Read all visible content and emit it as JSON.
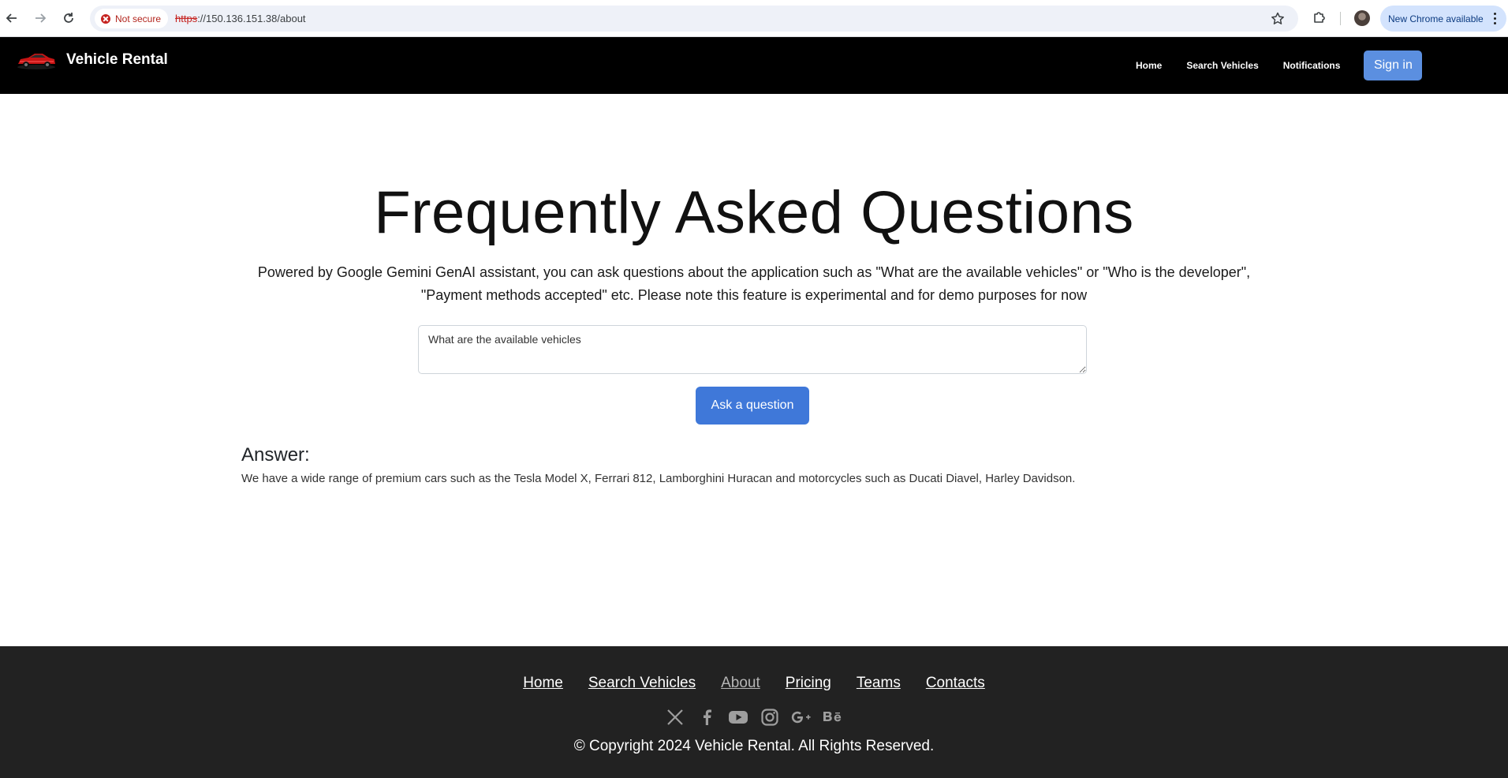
{
  "browser": {
    "security_label": "Not secure",
    "url_scheme": "https",
    "url_rest": "://150.136.151.38/about",
    "update_label": "New Chrome available"
  },
  "header": {
    "brand_name": "Vehicle Rental",
    "nav": [
      "Home",
      "Search Vehicles",
      "Notifications"
    ],
    "signin_label": "Sign in"
  },
  "main": {
    "title": "Frequently Asked Questions",
    "intro": "Powered by Google Gemini GenAI assistant, you can ask questions about the application such as \"What are the available vehicles\" or \"Who is the developer\", \"Payment methods accepted\" etc. Please note this feature is experimental and for demo purposes for now",
    "question_value": "What are the available vehicles",
    "ask_label": "Ask a question",
    "answer_heading": "Answer:",
    "answer_text": "We have a wide range of premium cars such as the Tesla Model X, Ferrari 812, Lamborghini Huracan and motorcycles such as Ducati Diavel, Harley Davidson."
  },
  "footer": {
    "links": [
      "Home",
      "Search Vehicles",
      "About",
      "Pricing",
      "Teams",
      "Contacts"
    ],
    "social_icons": [
      "x-icon",
      "facebook-icon",
      "youtube-icon",
      "instagram-icon",
      "google-plus-icon",
      "behance-icon"
    ],
    "copyright": "© Copyright 2024 Vehicle Rental. All Rights Reserved."
  },
  "colors": {
    "header_bg": "#000000",
    "footer_bg": "#222222",
    "primary_button": "#3f78d9",
    "signin_button": "#5b8fe0"
  }
}
